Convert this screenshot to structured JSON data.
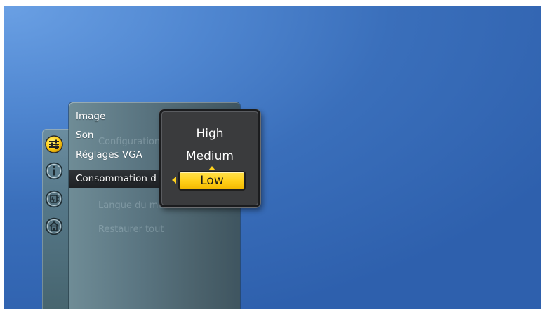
{
  "menu": {
    "items": [
      {
        "label": "Image"
      },
      {
        "label": "Son"
      },
      {
        "label": "Réglages VGA"
      },
      {
        "label": "Consommation d"
      }
    ],
    "ghost_items": [
      {
        "label": "Configuration"
      },
      {
        "label": "Langue du menu"
      },
      {
        "label": "Restaurer tout"
      }
    ]
  },
  "picker": {
    "options": [
      {
        "label": "High"
      },
      {
        "label": "Medium"
      },
      {
        "label": "Low"
      }
    ],
    "selected": "Low"
  },
  "icons": [
    "settings-icon",
    "info-icon",
    "energy-icon",
    "home-icon"
  ],
  "colors": {
    "background": "#3f77c4",
    "menu_panel": "#5b7682",
    "selected_row": "#26292c",
    "picker_bg": "#3a3b3d",
    "highlight": "#ffcf18"
  }
}
